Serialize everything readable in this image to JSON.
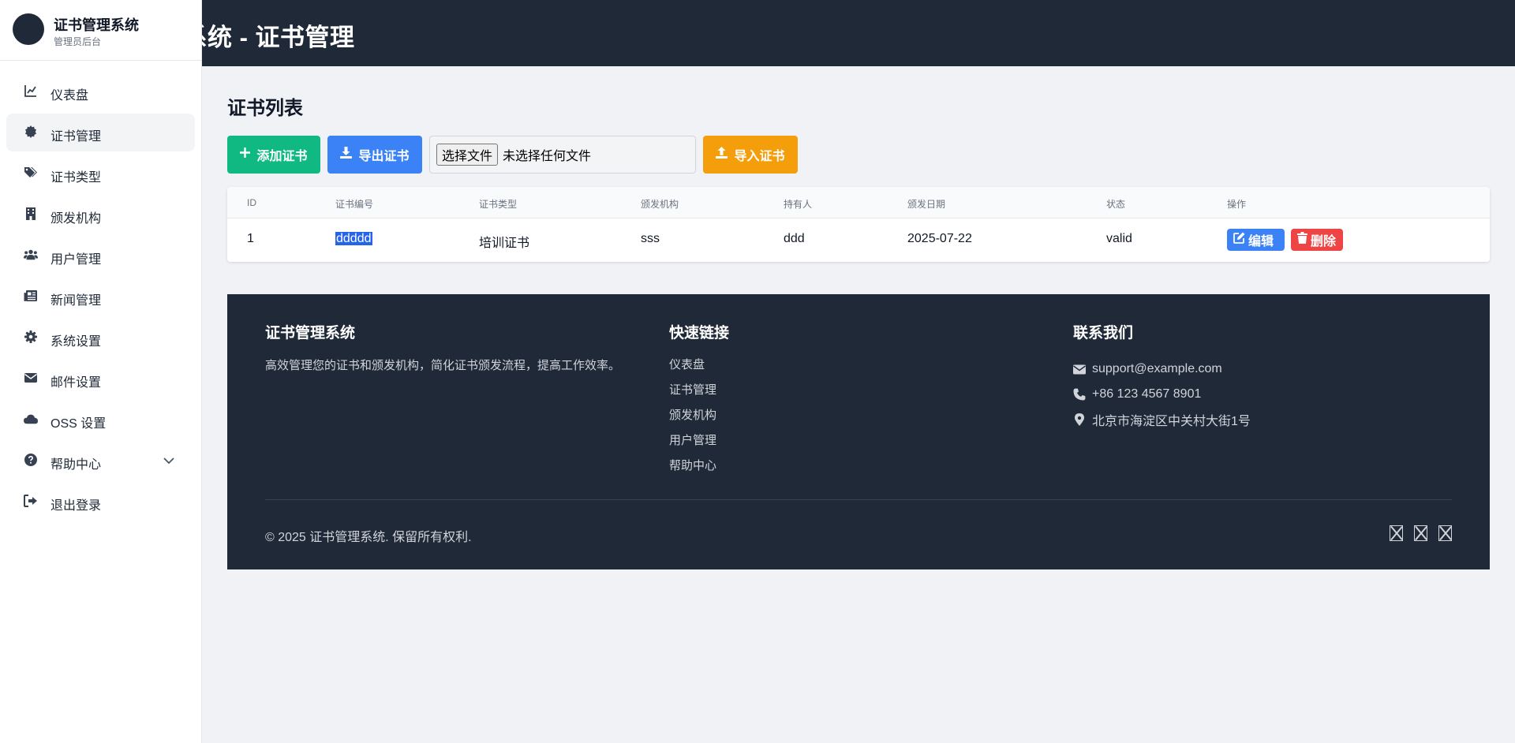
{
  "header": {
    "title": "证书管理系统 - 证书管理",
    "visible_title": "理系统 - 证书管理"
  },
  "sidebar": {
    "brand_title": "证书管理系统",
    "brand_subtitle": "管理员后台",
    "items": [
      {
        "label": "仪表盘",
        "icon": "chart-line-icon"
      },
      {
        "label": "证书管理",
        "icon": "certificate-icon",
        "active": true
      },
      {
        "label": "证书类型",
        "icon": "tags-icon"
      },
      {
        "label": "颁发机构",
        "icon": "building-icon"
      },
      {
        "label": "用户管理",
        "icon": "users-icon"
      },
      {
        "label": "新闻管理",
        "icon": "newspaper-icon"
      },
      {
        "label": "系统设置",
        "icon": "cog-icon"
      },
      {
        "label": "邮件设置",
        "icon": "envelope-icon"
      },
      {
        "label": "OSS 设置",
        "icon": "cloud-icon"
      },
      {
        "label": "帮助中心",
        "icon": "question-circle-icon",
        "expandable": true
      },
      {
        "label": "退出登录",
        "icon": "sign-out-icon"
      }
    ]
  },
  "main": {
    "section_title": "证书列表",
    "toolbar": {
      "add_label": "添加证书",
      "export_label": "导出证书",
      "file_button_label": "选择文件",
      "file_status": "未选择任何文件",
      "import_label": "导入证书"
    },
    "table": {
      "columns": [
        "ID",
        "证书编号",
        "证书类型",
        "颁发机构",
        "持有人",
        "颁发日期",
        "状态",
        "操作"
      ],
      "rows": [
        {
          "id": "1",
          "number": "ddddd",
          "type": "培训证书",
          "issuer": "sss",
          "holder": "ddd",
          "date": "2025-07-22",
          "status": "valid"
        }
      ],
      "edit_label": "编辑",
      "delete_label": "删除"
    }
  },
  "footer": {
    "about_title": "证书管理系统",
    "about_text": "高效管理您的证书和颁发机构，简化证书颁发流程，提高工作效率。",
    "links_title": "快速链接",
    "links": [
      "仪表盘",
      "证书管理",
      "颁发机构",
      "用户管理",
      "帮助中心"
    ],
    "contact_title": "联系我们",
    "email": "support@example.com",
    "phone": "+86 123 4567 8901",
    "address": "北京市海淀区中关村大街1号",
    "copyright": "© 2025 证书管理系统. 保留所有权利.",
    "social_icons": [
      "missing-glyph-icon",
      "missing-glyph-icon",
      "missing-glyph-icon"
    ]
  },
  "colors": {
    "dark": "#1f2937",
    "green": "#10b981",
    "blue": "#3b82f6",
    "amber": "#f59e0b",
    "red": "#ef4444"
  }
}
